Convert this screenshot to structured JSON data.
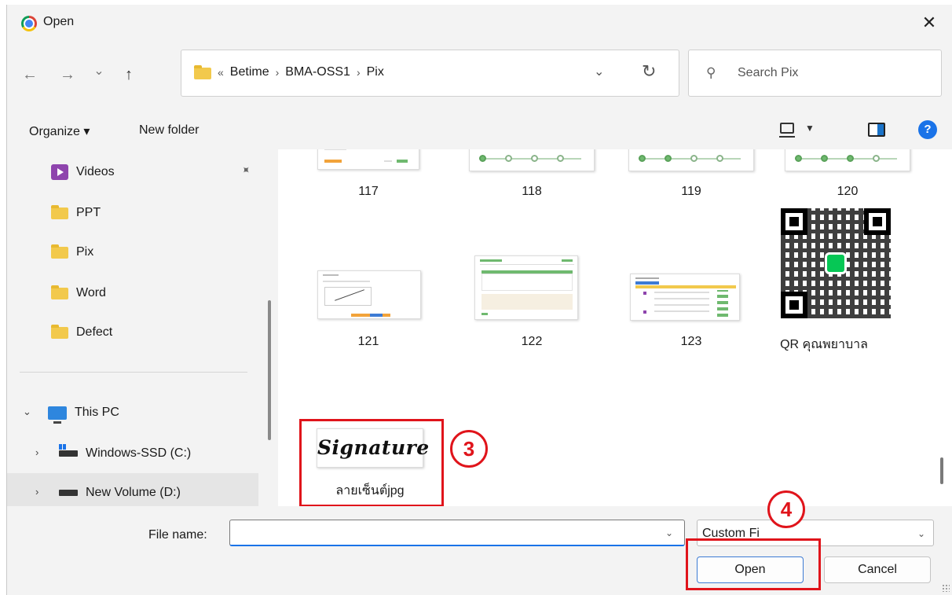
{
  "window": {
    "title": "Open",
    "close_glyph": "✕"
  },
  "nav": {
    "back_glyph": "←",
    "forward_glyph": "→",
    "recent_glyph": "⌄",
    "up_glyph": "↑",
    "crumb_overflow": "«",
    "breadcrumb": [
      "Betime",
      "BMA-OSS1",
      "Pix"
    ],
    "crumb_separator": "›",
    "dropdown_glyph": "⌄",
    "refresh_glyph": "↻",
    "search_placeholder": "Search Pix",
    "search_glyph": "⚲"
  },
  "toolbar": {
    "organize_label": "Organize ▾",
    "new_folder_label": "New folder",
    "view_dropdown_glyph": "▼",
    "help_glyph": "?"
  },
  "sidebar": {
    "items": [
      {
        "label": "Videos",
        "icon": "video-folder-icon",
        "pinned": true
      },
      {
        "label": "PPT",
        "icon": "folder-icon"
      },
      {
        "label": "Pix",
        "icon": "folder-icon"
      },
      {
        "label": "Word",
        "icon": "folder-icon"
      },
      {
        "label": "Defect",
        "icon": "folder-icon"
      }
    ],
    "pin_glyph": "📌",
    "this_pc": {
      "label": "This PC",
      "chevron": "⌄"
    },
    "drives": [
      {
        "label": "Windows-SSD (C:)",
        "chevron": "›"
      },
      {
        "label": "New Volume (D:)",
        "chevron": "›",
        "selected": true
      }
    ]
  },
  "files": [
    {
      "name": "117"
    },
    {
      "name": "118"
    },
    {
      "name": "119"
    },
    {
      "name": "120"
    },
    {
      "name": "121"
    },
    {
      "name": "122"
    },
    {
      "name": "123"
    },
    {
      "name": "QR คุณพยาบาล"
    },
    {
      "name": "ลายเซ็นต์jpg",
      "thumb_text": "Signature"
    }
  ],
  "annotations": {
    "step3": "3",
    "step4": "4",
    "color": "#e0141b"
  },
  "bottom": {
    "file_name_label": "File name:",
    "file_name_value": "",
    "file_type_value": "Custom Fi",
    "dropdown_glyph": "⌄",
    "open_label": "Open",
    "cancel_label": "Cancel"
  },
  "colors": {
    "accent": "#1a73e8",
    "folder": "#f2c94c",
    "thumb_green": "#6fb96f"
  }
}
